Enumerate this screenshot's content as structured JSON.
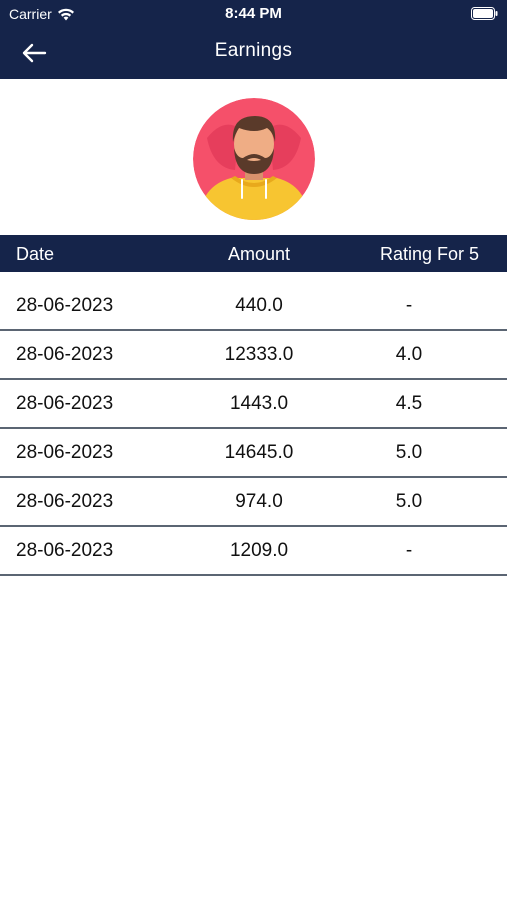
{
  "status_bar": {
    "carrier": "Carrier",
    "time": "8:44 PM"
  },
  "navbar": {
    "title": "Earnings",
    "back_icon": "arrow-left-icon"
  },
  "colors": {
    "primary": "#15244a",
    "divider": "#5b6573"
  },
  "table": {
    "headers": {
      "date": "Date",
      "amount": "Amount",
      "rating": "Rating For 5"
    },
    "rows": [
      {
        "date": "28-06-2023",
        "amount": "440.0",
        "rating": "-"
      },
      {
        "date": "28-06-2023",
        "amount": "12333.0",
        "rating": "4.0"
      },
      {
        "date": "28-06-2023",
        "amount": "1443.0",
        "rating": "4.5"
      },
      {
        "date": "28-06-2023",
        "amount": "14645.0",
        "rating": "5.0"
      },
      {
        "date": "28-06-2023",
        "amount": "974.0",
        "rating": "5.0"
      },
      {
        "date": "28-06-2023",
        "amount": "1209.0",
        "rating": "-"
      }
    ]
  }
}
